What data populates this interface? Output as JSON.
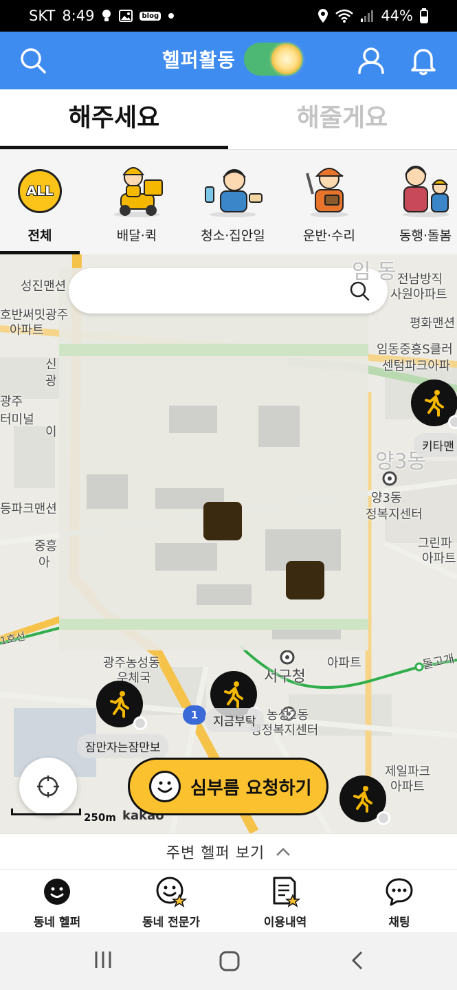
{
  "status_bar": {
    "carrier": "SKT",
    "time": "8:49",
    "battery": "44%",
    "blog_badge": "blog"
  },
  "app_bar": {
    "title": "헬퍼활동",
    "helper_toggle_on": true
  },
  "tabs": [
    {
      "label": "해주세요",
      "active": true
    },
    {
      "label": "해줄게요",
      "active": false
    }
  ],
  "categories": [
    {
      "label": "전체",
      "badge": "ALL",
      "active": true
    },
    {
      "label": "배달·퀵",
      "active": false
    },
    {
      "label": "청소·집안일",
      "active": false
    },
    {
      "label": "운반·수리",
      "active": false
    },
    {
      "label": "동행·돌봄",
      "active": false
    }
  ],
  "map": {
    "labels": [
      "성진맨션",
      "호반써밋광주",
      "아파트",
      "신",
      "광",
      "광주",
      "터미널",
      "이",
      "등파크맨션",
      "중흥",
      "아",
      "전남방직",
      "사원아파트",
      "평화맨션",
      "임동중흥S클러",
      "센텀파크아파",
      "양3동",
      "정복지센터",
      "그린파",
      "아파트",
      "광주농성동",
      "우체국",
      "서구청",
      "농성2동",
      "행정복지센터",
      "제일파크",
      "아파트",
      "1호선",
      "돌고개",
      "아파트",
      "1",
      "임 동",
      "양3동"
    ],
    "helpers": [
      {
        "name": "키타맨"
      },
      {
        "name": "잠만자는잠만보"
      },
      {
        "name": "지금부탁"
      }
    ],
    "scale_text": "250m",
    "provider": "kakao"
  },
  "request_button": {
    "label": "심부름 요청하기"
  },
  "nearby_helpers": {
    "label": "주변 헬퍼 보기"
  },
  "bottom_nav": [
    {
      "label": "동네 헬퍼",
      "icon": "smile-filled-icon"
    },
    {
      "label": "동네 전문가",
      "icon": "smile-star-icon"
    },
    {
      "label": "이용내역",
      "icon": "document-star-icon"
    },
    {
      "label": "채팅",
      "icon": "chat-bubble-icon"
    }
  ],
  "colors": {
    "app_bar": "#3f8cf0",
    "toggle_on": "#4cb873",
    "accent_yellow": "#fcc12f",
    "map_bg": "#ecebe5"
  }
}
